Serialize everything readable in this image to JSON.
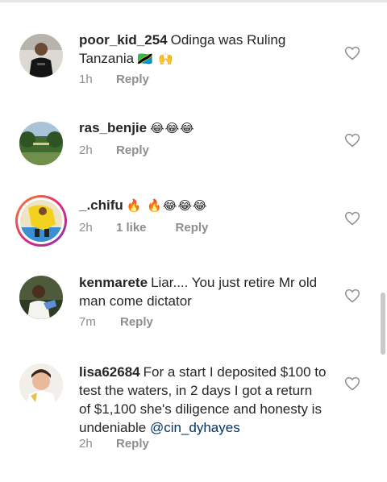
{
  "comments": [
    {
      "username": "poor_kid_254",
      "text": "Odinga was Ruling Tanzania",
      "emoji": "🇹🇿 🙌",
      "time": "1h",
      "likes": "",
      "reply": "Reply"
    },
    {
      "username": "ras_benjie",
      "text": "",
      "emoji": "😂😂😂",
      "time": "2h",
      "likes": "",
      "reply": "Reply"
    },
    {
      "username": "_.chifu",
      "text": "",
      "emoji": "🔥 🔥😂😂😂",
      "time": "2h",
      "likes": "1 like",
      "reply": "Reply"
    },
    {
      "username": "kenmarete",
      "text": "Liar.... You just retire Mr old man come dictator",
      "emoji": "",
      "time": "7m",
      "likes": "",
      "reply": "Reply"
    },
    {
      "username": "lisa62684",
      "text": "For a start I deposited $100 to test the waters, in 2 days I got a return of $1,100 she's diligence and honesty is undeniable",
      "mention": "@cin_dyhayes",
      "emoji": "",
      "time": "2h",
      "likes": "",
      "reply": "Reply"
    }
  ],
  "icons": {
    "like": "heart-outline-icon"
  },
  "colors": {
    "text": "#262626",
    "meta": "#8e8e8e",
    "mention": "#003569",
    "heart": "#8e8e8e"
  }
}
